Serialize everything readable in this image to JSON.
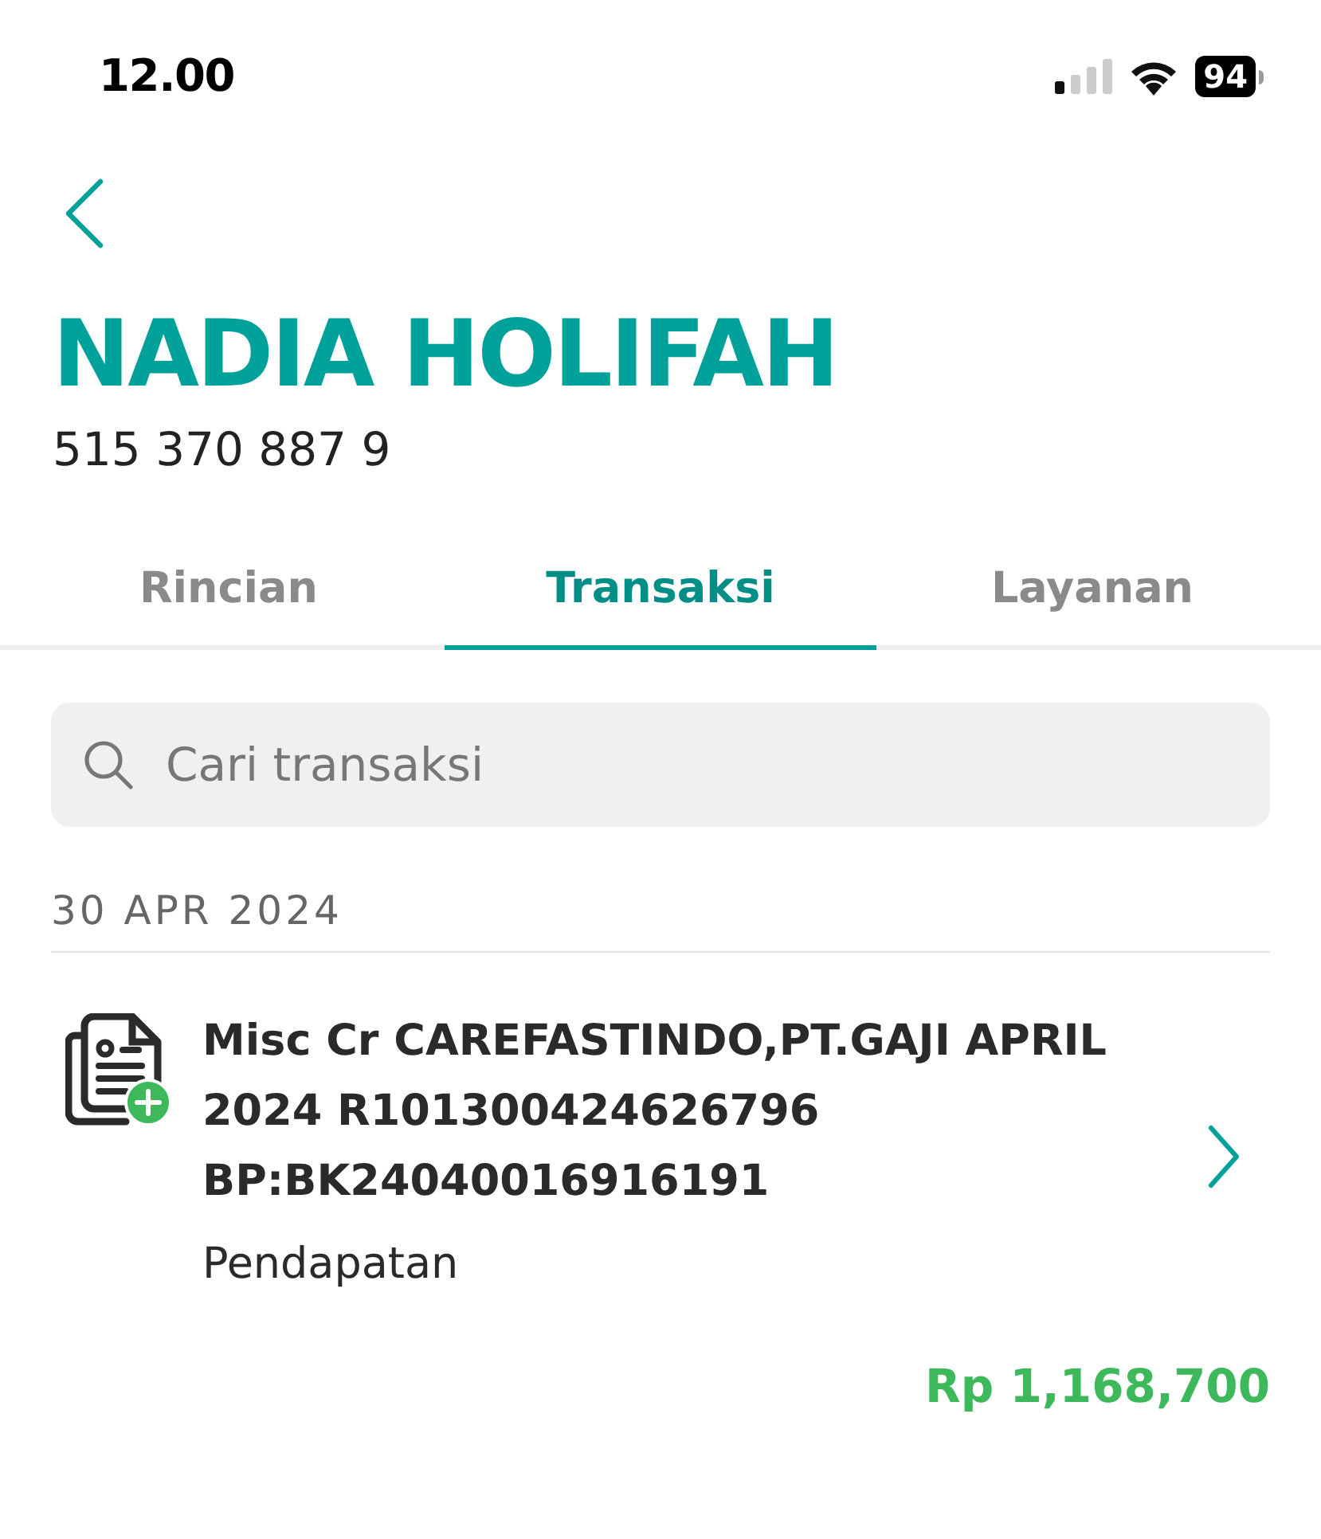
{
  "status_bar": {
    "time": "12.00",
    "battery": "94"
  },
  "account": {
    "name": "NADIA HOLIFAH",
    "number": "515 370 887 9"
  },
  "tabs": [
    {
      "label": "Rincian",
      "selected": false
    },
    {
      "label": "Transaksi",
      "selected": true
    },
    {
      "label": "Layanan",
      "selected": false
    }
  ],
  "search": {
    "placeholder": "Cari transaksi"
  },
  "groups": [
    {
      "date": "30 APR 2024",
      "transactions": [
        {
          "title": "Misc Cr CAREFASTINDO,PT.GAJI APRIL 2024 R101300424626796 BP:BK24040016916191",
          "category": "Pendapatan",
          "amount": "Rp 1,168,700",
          "kind": "credit"
        }
      ]
    }
  ]
}
